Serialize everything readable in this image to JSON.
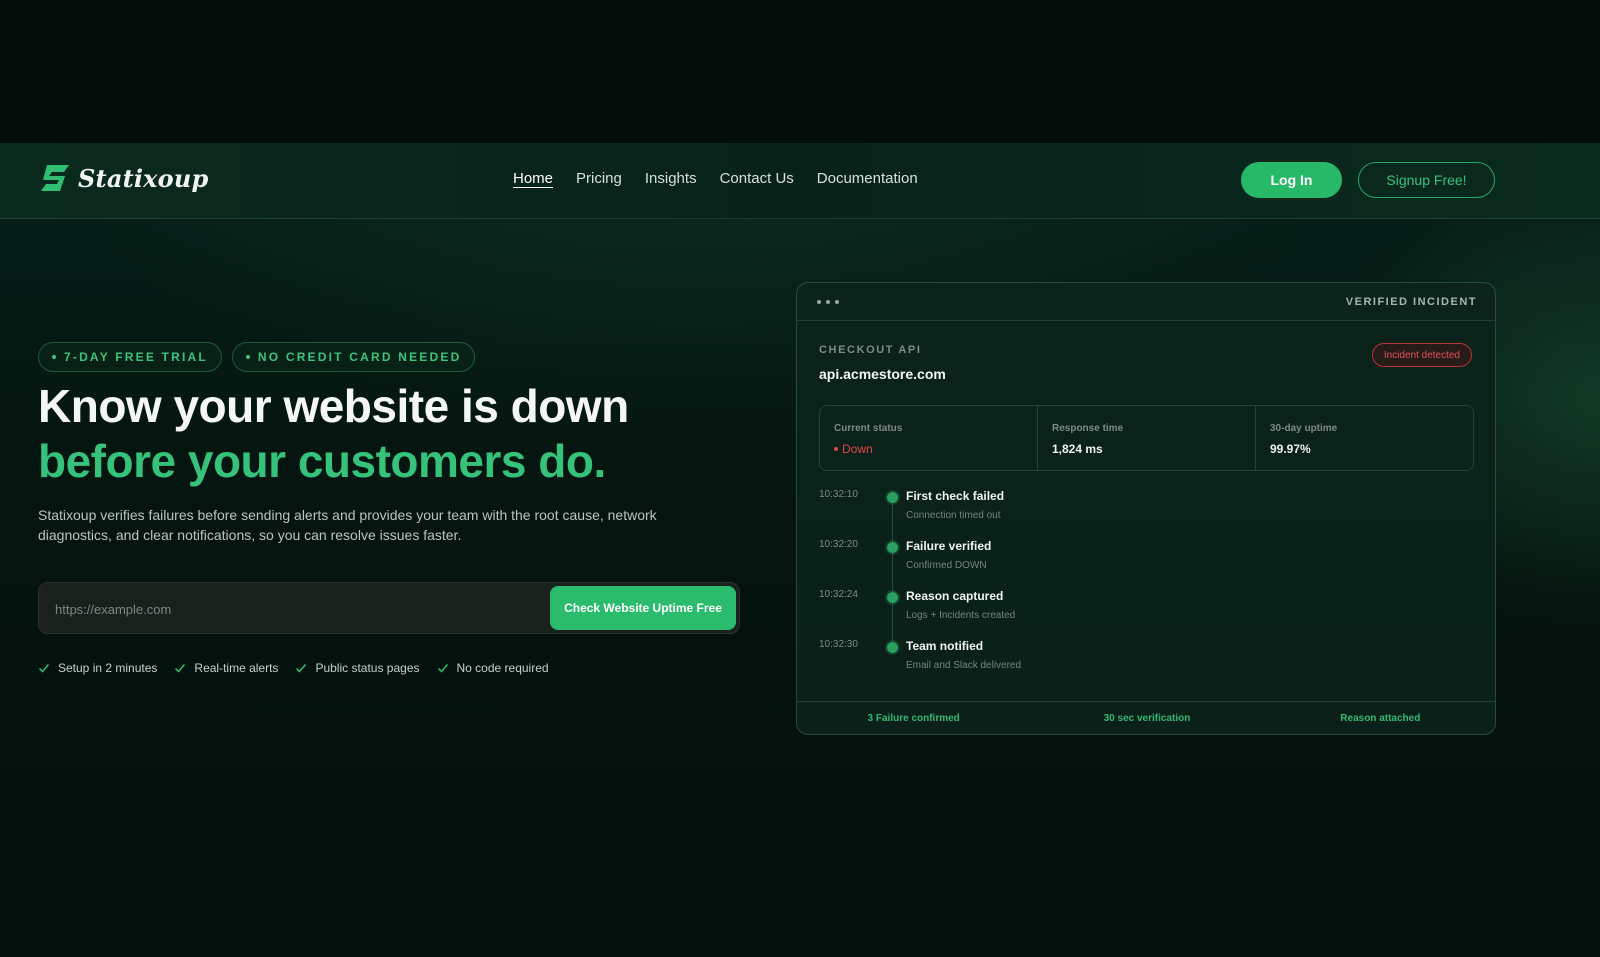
{
  "brand": {
    "name": "Statixoup"
  },
  "nav": {
    "links": [
      "Home",
      "Pricing",
      "Insights",
      "Contact Us",
      "Documentation"
    ],
    "active": "Home",
    "login_label": "Log In",
    "signup_label": "Signup Free!"
  },
  "hero": {
    "badges": [
      "7-DAY FREE TRIAL",
      "NO CREDIT CARD NEEDED"
    ],
    "title_line1": "Know your website is down",
    "title_line2": "before your customers do.",
    "description": "Statixoup verifies failures before sending alerts and provides your team with the root cause, network diagnostics, and clear notifications, so you can resolve issues faster.",
    "input_placeholder": "https://example.com",
    "cta_label": "Check Website Uptime Free",
    "features": [
      "Setup in 2 minutes",
      "Real-time alerts",
      "Public status pages",
      "No code required"
    ]
  },
  "incident_card": {
    "header_title": "VERIFIED INCIDENT",
    "service_label": "CHECKOUT API",
    "service_host": "api.acmestore.com",
    "status_pill": "Incident detected",
    "stats": [
      {
        "label": "Current status",
        "value": "Down"
      },
      {
        "label": "Response time",
        "value": "1,824 ms"
      },
      {
        "label": "30-day uptime",
        "value": "99.97%"
      }
    ],
    "timeline": [
      {
        "time": "10:32:10",
        "title": "First check failed",
        "subtitle": "Connection timed out"
      },
      {
        "time": "10:32:20",
        "title": "Failure verified",
        "subtitle": "Confirmed DOWN"
      },
      {
        "time": "10:32:24",
        "title": "Reason captured",
        "subtitle": "Logs + Incidents created"
      },
      {
        "time": "10:32:30",
        "title": "Team notified",
        "subtitle": "Email and Slack delivered"
      }
    ],
    "footer": [
      "3 Failure confirmed",
      "30 sec verification",
      "Reason attached"
    ]
  },
  "colors": {
    "accent": "#2bbb6d",
    "accent_text": "#35c27a",
    "danger": "#e0454c",
    "background": "#040e0a"
  },
  "icons": {
    "logo": "lightning-s-logo-icon",
    "feature_check": "check-icon"
  }
}
